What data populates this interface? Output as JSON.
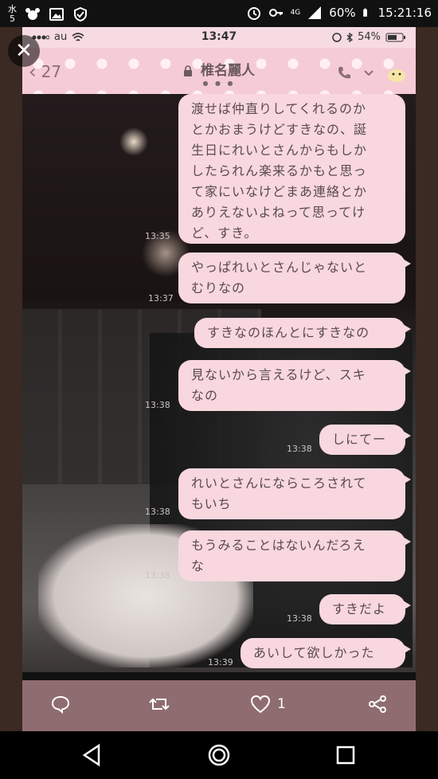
{
  "outer_status": {
    "date_char": "水",
    "date_num": "5",
    "battery": "60%",
    "time": "15:21:16",
    "network": "4G"
  },
  "viewer": {
    "close_label": "✕"
  },
  "inner_status": {
    "carrier": "au",
    "time": "13:47",
    "battery": "54%"
  },
  "chat_header": {
    "back_count": "27",
    "contact_name": "椎名麗人",
    "page_dots": "● ● ●"
  },
  "messages": [
    {
      "text": "渡せば仲直りしてくれるのか\nとかおまうけどすきなの、誕\n生日にれいとさんからもしか\nしたられん楽来るかもと思っ\nて家にいなけどまあ連絡とか\nありえないよねって思ってけ\nど、すき。",
      "time": "13:35"
    },
    {
      "text": "やっぱれいとさんじゃないと\nむりなの",
      "time": "13:37"
    },
    {
      "text": "すきなのほんとにすきなの",
      "time": ""
    },
    {
      "text": "見ないから言えるけど、スキ\nなの",
      "time": "13:38"
    },
    {
      "text": "しにてー",
      "time": "13:38"
    },
    {
      "text": "れいとさんにならころされて\nもいち",
      "time": "13:38"
    },
    {
      "text": "もうみることはないんだろえ\nな",
      "time": "13:38"
    },
    {
      "text": "すきだよ",
      "time": "13:38"
    },
    {
      "text": "あいして欲しかった",
      "time": "13:39"
    }
  ],
  "action_bar": {
    "like_count": "1"
  },
  "icons": {
    "comment": "comment-icon",
    "retweet": "retweet-icon",
    "like": "heart-icon",
    "share": "share-icon"
  }
}
